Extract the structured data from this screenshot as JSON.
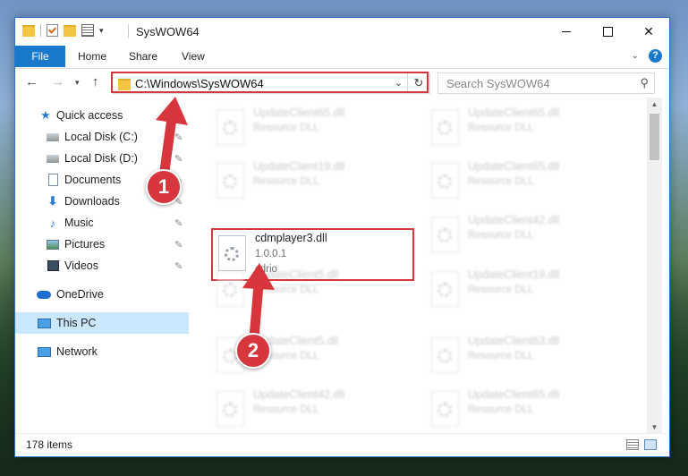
{
  "window": {
    "title": "SysWOW64",
    "controls": {
      "minimize_icon": "minimize-icon",
      "maximize_icon": "maximize-icon",
      "close_icon": "close-icon",
      "close_glyph": "✕"
    }
  },
  "ribbon": {
    "tabs": [
      "File",
      "Home",
      "Share",
      "View"
    ],
    "help_glyph": "?",
    "expand_glyph": "⌄"
  },
  "navigation": {
    "back_glyph": "←",
    "forward_glyph": "→",
    "recent_glyph": "▾",
    "up_glyph": "↑",
    "address": "C:\\Windows\\SysWOW64",
    "address_dropdown_glyph": "⌄",
    "refresh_glyph": "↻",
    "search_placeholder": "Search SysWOW64",
    "search_glyph": "⚲"
  },
  "sidebar": {
    "items": [
      {
        "label": "Quick access",
        "icon": "star-icon",
        "glyph": "★",
        "pinned": false
      },
      {
        "label": "Local Disk (C:)",
        "icon": "disk-icon",
        "glyph": "",
        "pinned": true
      },
      {
        "label": "Local Disk (D:)",
        "icon": "disk-icon",
        "glyph": "",
        "pinned": true
      },
      {
        "label": "Documents",
        "icon": "documents-icon",
        "glyph": "",
        "pinned": true
      },
      {
        "label": "Downloads",
        "icon": "download-icon",
        "glyph": "⬇",
        "pinned": true
      },
      {
        "label": "Music",
        "icon": "music-icon",
        "glyph": "♪",
        "pinned": true
      },
      {
        "label": "Pictures",
        "icon": "pictures-icon",
        "glyph": "",
        "pinned": true
      },
      {
        "label": "Videos",
        "icon": "videos-icon",
        "glyph": "",
        "pinned": true
      },
      {
        "label": "OneDrive",
        "icon": "onedrive-icon",
        "glyph": "",
        "pinned": false
      },
      {
        "label": "This PC",
        "icon": "this-pc-icon",
        "glyph": "",
        "pinned": false,
        "selected": true
      },
      {
        "label": "Network",
        "icon": "network-icon",
        "glyph": "",
        "pinned": false
      }
    ],
    "pin_glyph": "📌"
  },
  "files": {
    "left_column": [
      {
        "name": "UpdateClient65.dll",
        "description": "Resource DLL",
        "blurred": true
      },
      {
        "name": "UpdateClient19.dll",
        "description": "Resource DLL",
        "blurred": true
      },
      {
        "name": "cdmplayer3.dll",
        "version": "1.0.0.1",
        "description": "cdrio",
        "blurred": false,
        "highlighted": true
      },
      {
        "name": "UpdateClient5.dll",
        "description": "Resource DLL",
        "blurred": true
      },
      {
        "name": "UpdateClient5.dll",
        "description": "Resource DLL",
        "blurred": true
      },
      {
        "name": "UpdateClient42.dll",
        "description": "Resource DLL",
        "blurred": true
      }
    ],
    "right_column": [
      {
        "name": "UpdateClient65.dll",
        "description": "Resource DLL",
        "blurred": true
      },
      {
        "name": "UpdateClient65.dll",
        "description": "Resource DLL",
        "blurred": true
      },
      {
        "name": "UpdateClient42.dll",
        "description": "Resource DLL",
        "blurred": true
      },
      {
        "name": "UpdateClient19.dll",
        "description": "Resource DLL",
        "blurred": true
      },
      {
        "name": "UpdateClient63.dll",
        "description": "Resource DLL",
        "blurred": true
      },
      {
        "name": "UpdateClient65.dll",
        "description": "Resource DLL",
        "blurred": true
      }
    ]
  },
  "status": {
    "item_count": "178 items"
  },
  "annotations": {
    "step1": "1",
    "step2": "2",
    "accent_color": "#d7373c"
  },
  "colors": {
    "file_tab": "#1979ca",
    "selection": "#cce8ff"
  }
}
